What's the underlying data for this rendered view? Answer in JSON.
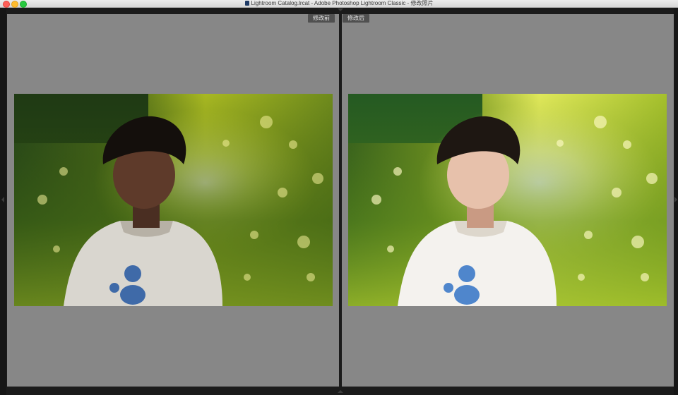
{
  "window": {
    "title": "Lightroom Catalog.lrcat - Adobe Photoshop Lightroom Classic - 修改照片",
    "traffic_lights": [
      "close",
      "minimize",
      "zoom"
    ]
  },
  "compare": {
    "before_label": "修改前",
    "after_label": "修改后"
  },
  "photo": {
    "subject": "child-with-mickey-tshirt-in-backlit-garden",
    "before_exposure": "dark",
    "after_exposure": "bright"
  },
  "colors": {
    "pane_bg": "#878787",
    "chrome_bg": "#1b1b1b",
    "label_bg": "#505050"
  }
}
